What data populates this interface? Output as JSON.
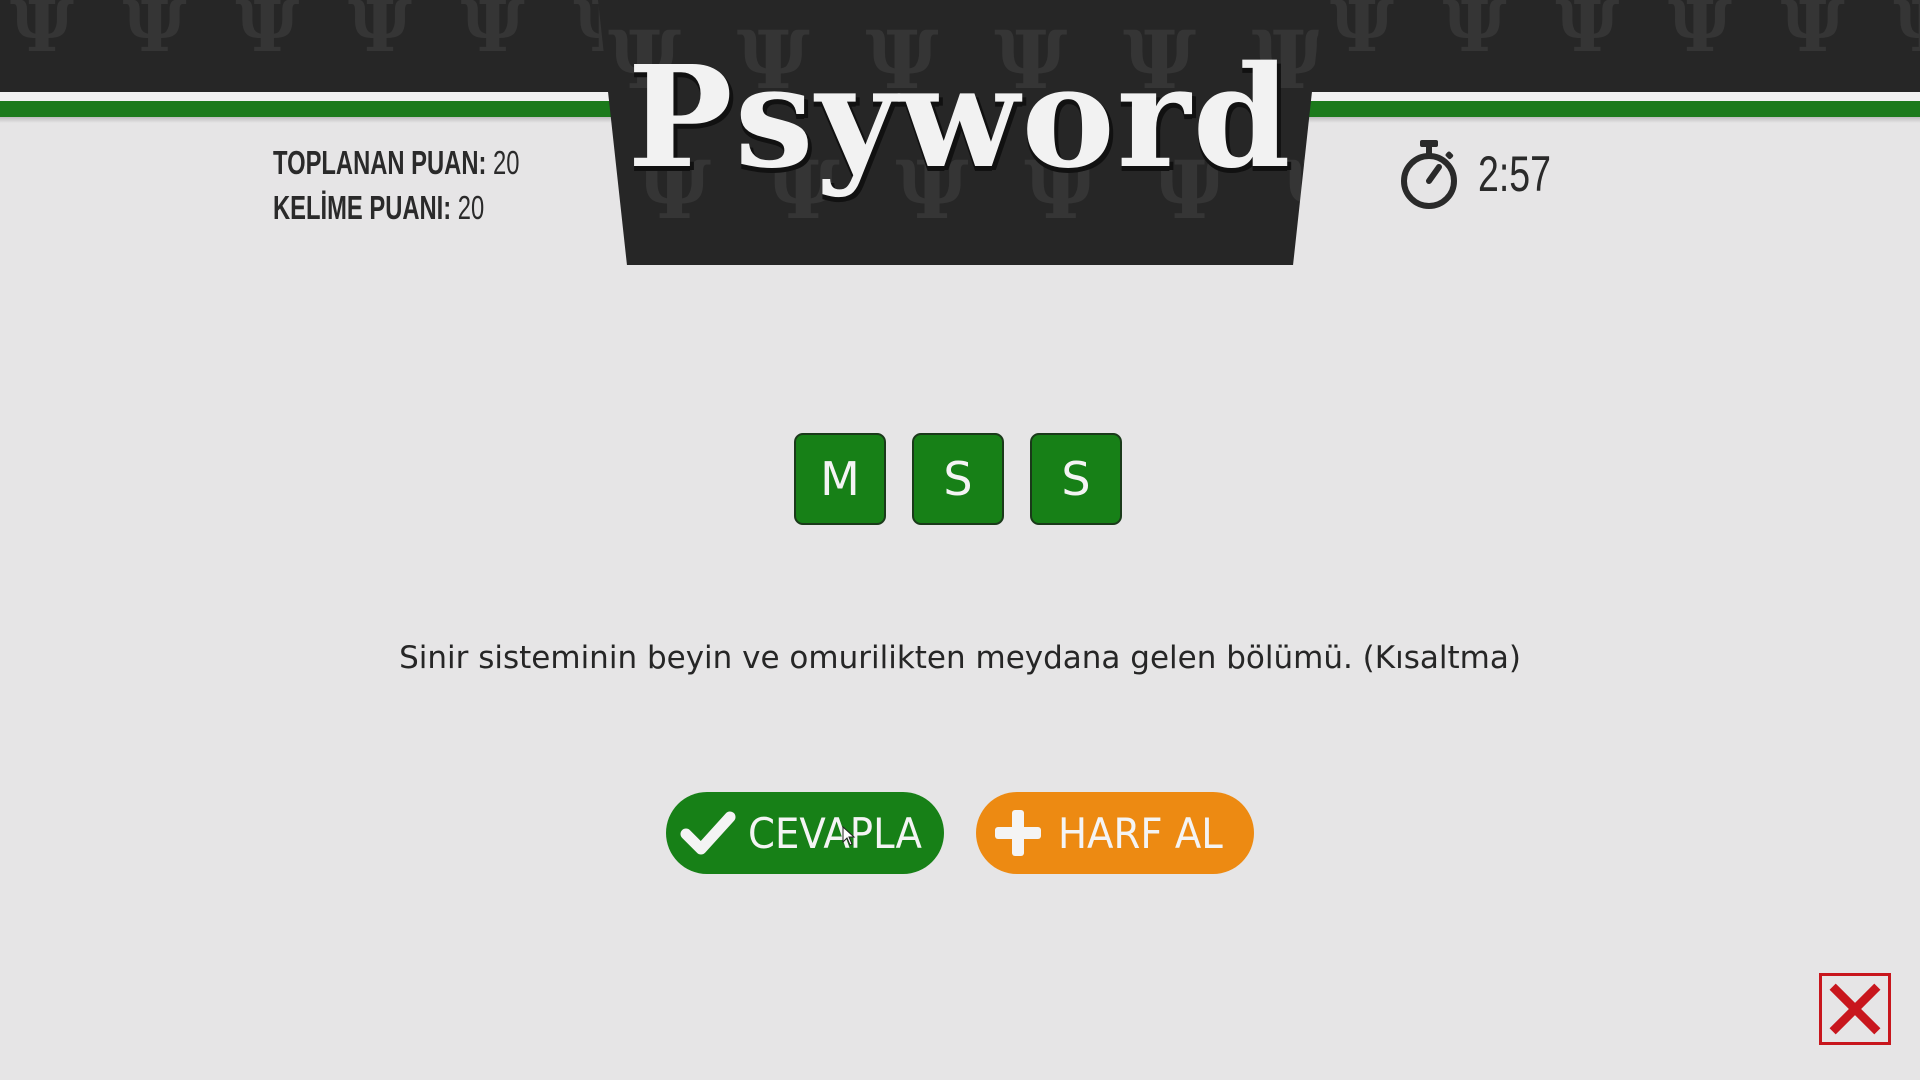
{
  "header": {
    "logo_text": "Psyword",
    "background_glyphs": "Ψ"
  },
  "scores": {
    "total_label": "TOPLANAN PUAN:",
    "total_value": "20",
    "word_label": "KELİME PUANI:",
    "word_value": "20"
  },
  "timer": {
    "icon": "stopwatch-icon",
    "value": "2:57"
  },
  "puzzle": {
    "letters": [
      "M",
      "S",
      "S"
    ],
    "clue": "Sinir sisteminin beyin ve omurilikten meydana gelen bölümü. (Kısaltma)"
  },
  "actions": {
    "answer_label": "CEVAPLA",
    "answer_icon": "checkmark-icon",
    "hint_label": "HARF AL",
    "hint_icon": "plus-icon",
    "close_icon": "close-icon"
  },
  "colors": {
    "primary_green": "#178017",
    "accent_orange": "#ed8a12",
    "header_dark": "#262626",
    "close_red": "#c8161d",
    "background": "#e6e5e6"
  }
}
